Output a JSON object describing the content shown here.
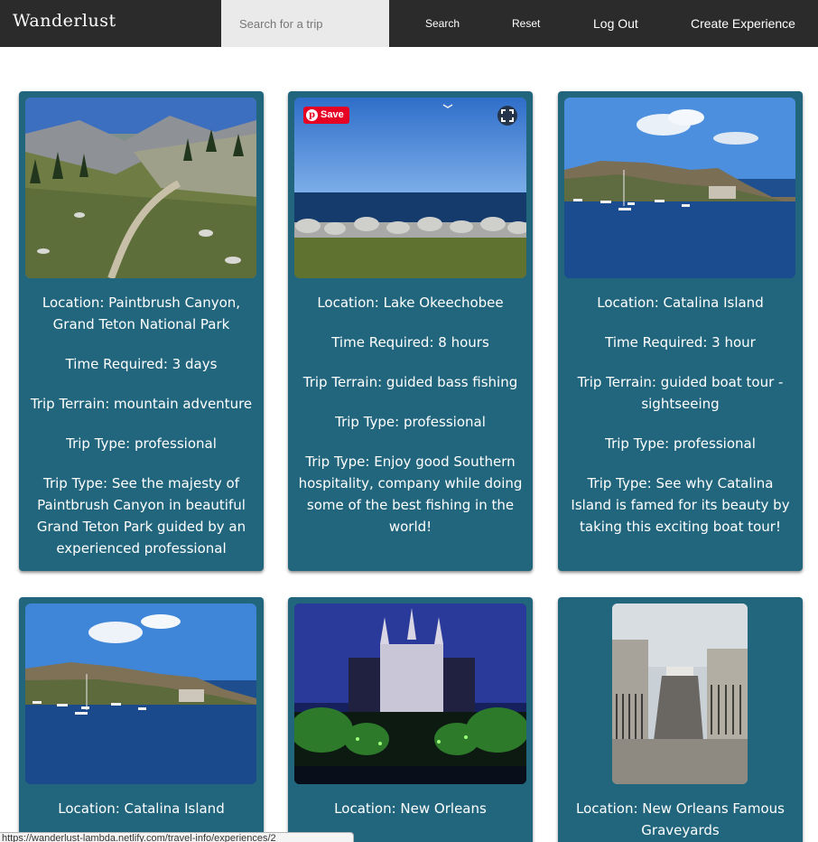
{
  "navbar": {
    "brand": "Wanderlust",
    "search_placeholder": "Search for a trip",
    "search_label": "Search",
    "reset_label": "Reset",
    "logout_label": "Log Out",
    "create_label": "Create Experience"
  },
  "cards": [
    {
      "location": "Location: Paintbrush Canyon, Grand Teton National Park",
      "time": "Time Required: 3 days",
      "terrain": "Trip Terrain: mountain adventure",
      "type": "Trip Type: professional",
      "description": "Trip Type: See the majesty of Paintbrush Canyon in beautiful Grand Teton Park guided by an experienced professional",
      "image": "mountain-trail-photo"
    },
    {
      "location": "Location: Lake Okeechobee",
      "time": "Time Required: 8 hours",
      "terrain": "Trip Terrain: guided bass fishing",
      "type": "Trip Type: professional",
      "description": "Trip Type: Enjoy good Southern hospitality, company while doing some of the best fishing in the world!",
      "image": "lake-shore-photo",
      "save_label": "Save"
    },
    {
      "location": "Location: Catalina Island",
      "time": "Time Required: 3 hour",
      "terrain": "Trip Terrain: guided boat tour - sightseeing",
      "type": "Trip Type: professional",
      "description": "Trip Type: See why Catalina Island is famed for its beauty by taking this exciting boat tour!",
      "image": "harbor-photo"
    },
    {
      "location": "Location: Catalina Island",
      "image": "harbor-photo"
    },
    {
      "location": "Location: New Orleans",
      "image": "night-cathedral-photo"
    },
    {
      "location": "Location: New Orleans Famous Graveyards",
      "image": "cemetery-photo"
    }
  ],
  "status_bar": {
    "url": "https://wanderlust-lambda.netlify.com/travel-info/experiences/2"
  },
  "colors": {
    "navbar": "#2b2b2b",
    "card": "#22667e",
    "pinterest": "#e60023"
  }
}
